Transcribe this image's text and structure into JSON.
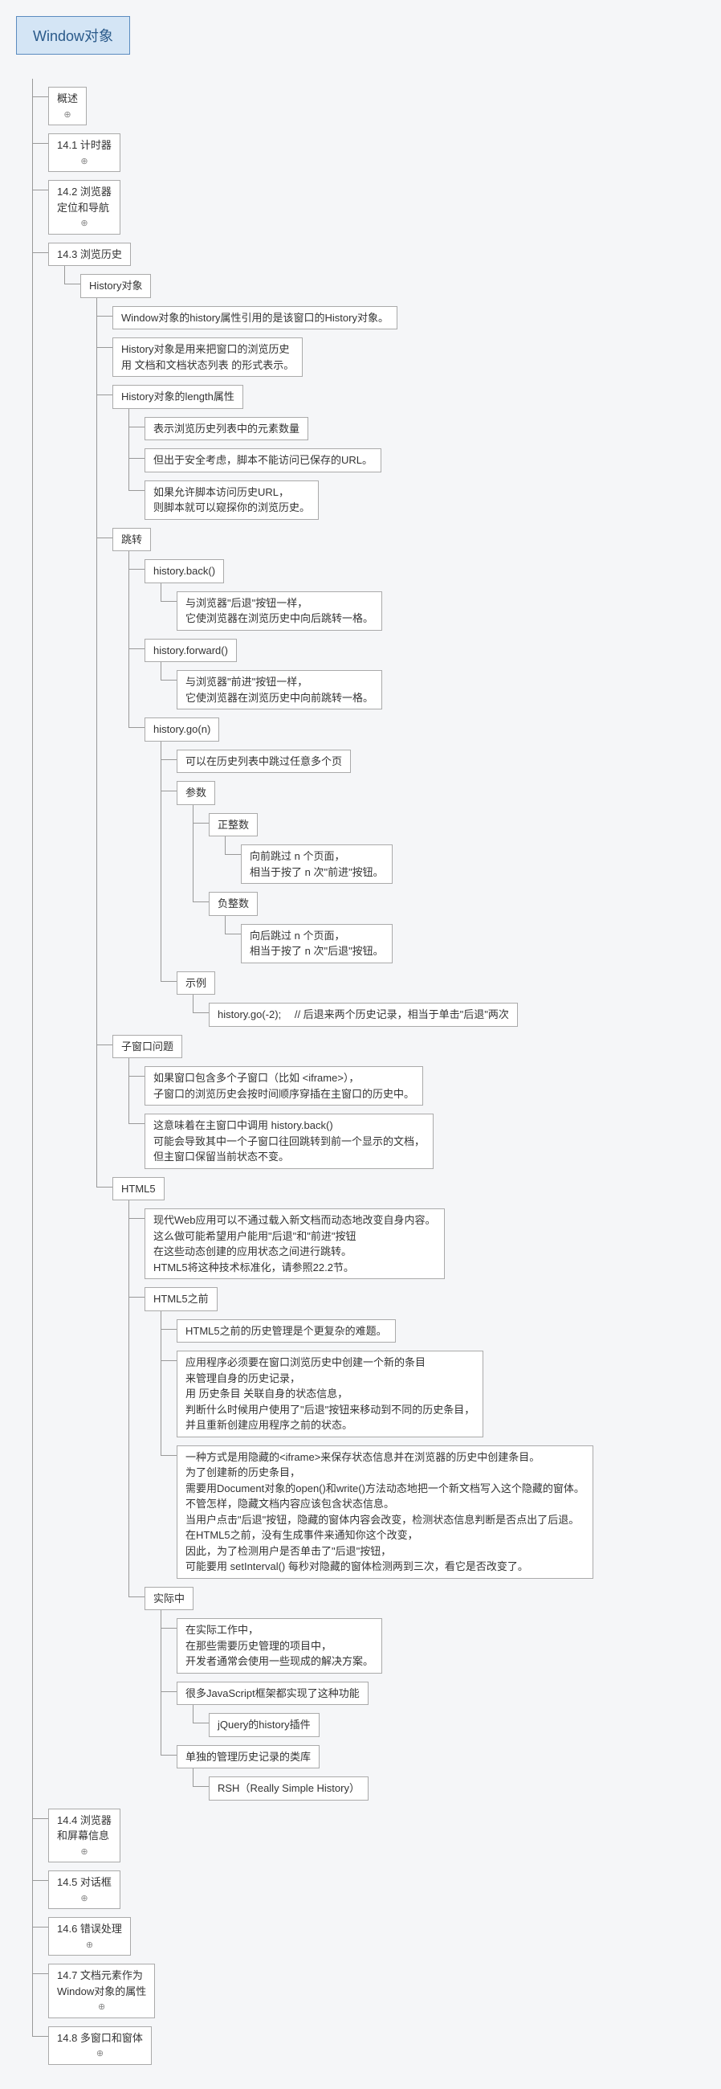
{
  "root": "Window对象",
  "s_overview": "概述",
  "s_141": "14.1 计时器",
  "s_142": "14.2 浏览器\n定位和导航",
  "s_143": "14.3 浏览历史",
  "s_144": "14.4 浏览器\n和屏幕信息",
  "s_145": "14.5 对话框",
  "s_146": "14.6 错误处理",
  "s_147": "14.7 文档元素作为\nWindow对象的属性",
  "s_148": "14.8 多窗口和窗体",
  "history_obj": "History对象",
  "history_obj_1": "Window对象的history属性引用的是该窗口的History对象。",
  "history_obj_2": "History对象是用来把窗口的浏览历史\n用 文档和文档状态列表 的形式表示。",
  "history_len": "History对象的length属性",
  "history_len_1": "表示浏览历史列表中的元素数量",
  "history_len_2": "但出于安全考虑，脚本不能访问已保存的URL。",
  "history_len_3": "如果允许脚本访问历史URL，\n则脚本就可以窥探你的浏览历史。",
  "jump": "跳转",
  "back": "history.back()",
  "back_1": "与浏览器\"后退\"按钮一样，\n它使浏览器在浏览历史中向后跳转一格。",
  "fwd": "history.forward()",
  "fwd_1": "与浏览器\"前进\"按钮一样，\n它使浏览器在浏览历史中向前跳转一格。",
  "go": "history.go(n)",
  "go_1": "可以在历史列表中跳过任意多个页",
  "go_param": "参数",
  "go_pos": "正整数",
  "go_pos_1": "向前跳过 n 个页面，\n相当于按了 n 次\"前进\"按钮。",
  "go_neg": "负整数",
  "go_neg_1": "向后跳过 n 个页面，\n相当于按了 n 次\"后退\"按钮。",
  "go_ex": "示例",
  "go_ex_1": "history.go(-2); 　// 后退来两个历史记录，相当于单击\"后退\"两次",
  "subwin": "子窗口问题",
  "subwin_1": "如果窗口包含多个子窗口（比如 <iframe>），\n子窗口的浏览历史会按时间顺序穿插在主窗口的历史中。",
  "subwin_2": "这意味着在主窗口中调用 history.back()\n可能会导致其中一个子窗口往回跳转到前一个显示的文档，\n但主窗口保留当前状态不变。",
  "html5": "HTML5",
  "html5_1": "现代Web应用可以不通过载入新文档而动态地改变自身内容。\n这么做可能希望用户能用\"后退\"和\"前进\"按钮\n在这些动态创建的应用状态之间进行跳转。\nHTML5将这种技术标准化，请参照22.2节。",
  "before": "HTML5之前",
  "before_1": "HTML5之前的历史管理是个更复杂的难题。",
  "before_2": "应用程序必须要在窗口浏览历史中创建一个新的条目\n来管理自身的历史记录，\n用 历史条目 关联自身的状态信息，\n判断什么时候用户使用了\"后退\"按钮来移动到不同的历史条目，\n并且重新创建应用程序之前的状态。",
  "before_3": "一种方式是用隐藏的<iframe>来保存状态信息并在浏览器的历史中创建条目。\n为了创建新的历史条目，\n需要用Document对象的open()和write()方法动态地把一个新文档写入这个隐藏的窗体。\n不管怎样，隐藏文档内容应该包含状态信息。\n当用户点击\"后退\"按钮，隐藏的窗体内容会改变，检测状态信息判断是否点出了后退。\n在HTML5之前，没有生成事件来通知你这个改变，\n因此，为了检测用户是否单击了\"后退\"按钮，\n可能要用 setInterval() 每秒对隐藏的窗体检测两到三次，看它是否改变了。",
  "practice": "实际中",
  "practice_1": "在实际工作中，\n在那些需要历史管理的项目中，\n开发者通常会使用一些现成的解决方案。",
  "practice_2": "很多JavaScript框架都实现了这种功能",
  "practice_2_1": "jQuery的history插件",
  "practice_3": "单独的管理历史记录的类库",
  "practice_3_1": "RSH（Really Simple History）"
}
